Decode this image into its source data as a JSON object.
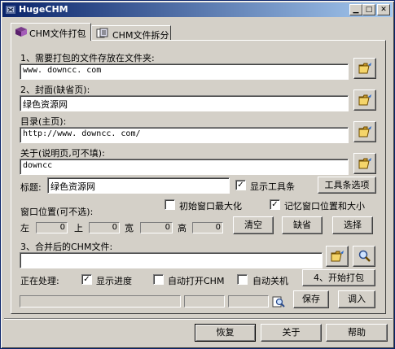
{
  "window": {
    "title": "HugeCHM"
  },
  "tabs": [
    {
      "label": "CHM文件打包"
    },
    {
      "label": "CHM文件拆分"
    }
  ],
  "pack": {
    "source_label": "1、需要打包的文件存放在文件夹:",
    "source_value": "www. downcc. com",
    "cover_label": "2、封面(缺省页):",
    "cover_value": "绿色资源网",
    "toc_label": "目录(主页):",
    "toc_value": "http://www. downcc. com/",
    "about_label": "关于(说明页,可不填):",
    "about_value": "downcc",
    "title_label": "标题:",
    "title_value": "绿色资源网",
    "show_toolbar_label": "显示工具条",
    "show_toolbar_checked": true,
    "toolbar_options_button": "工具条选项",
    "window_pos_label": "窗口位置(可不选):",
    "init_maximize_label": "初始窗口最大化",
    "init_maximize_checked": false,
    "remember_pos_label": "记忆窗口位置和大小",
    "remember_pos_checked": true,
    "left_label": "左",
    "left_value": "0",
    "top_label": "上",
    "top_value": "0",
    "width_label": "宽",
    "width_value": "0",
    "height_label": "高",
    "height_value": "0",
    "clear_button": "清空",
    "default_button": "缺省",
    "select_button": "选择",
    "output_label": "3、合并后的CHM文件:",
    "output_value": "",
    "processing_label": "正在处理:",
    "show_progress_label": "显示进度",
    "show_progress_checked": true,
    "auto_open_label": "自动打开CHM",
    "auto_open_checked": false,
    "auto_shutdown_label": "自动关机",
    "auto_shutdown_checked": false,
    "start_button": "4、开始打包",
    "save_button": "保存",
    "load_button": "调入"
  },
  "footer": {
    "restore_button": "恢复",
    "about_button": "关于",
    "help_button": "帮助"
  },
  "icons": {
    "browse": "open-folder-icon",
    "search": "magnifier-icon",
    "tab_pack": "book-icon",
    "tab_split": "pages-icon"
  }
}
